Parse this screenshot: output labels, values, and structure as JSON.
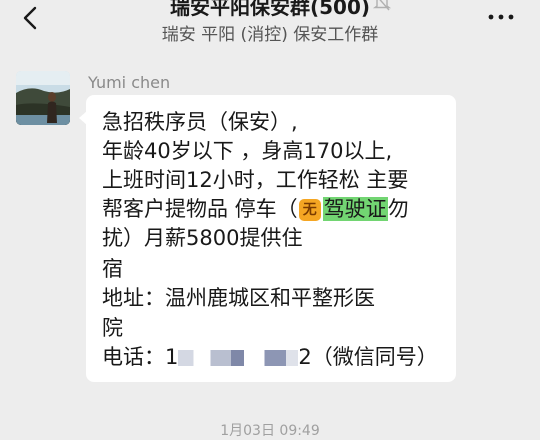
{
  "header": {
    "title": "瑞安平阳保安群(500)",
    "subtitle": "瑞安 平阳 (消控) 保安工作群"
  },
  "message": {
    "sender": "Yumi chen",
    "lines": [
      "急招秩序员（保安）,",
      "年龄40岁以下 ，身高170以上,",
      "上班时间12小时，工作轻松 主要",
      "帮客户提物品 停车（",
      "无",
      "驾驶证",
      "勿",
      "扰）月薪5800提供住",
      "宿",
      "地址：温州鹿城区和平整形医",
      "院",
      "电话：",
      "1",
      "2（微信同号）"
    ]
  },
  "timestamp": "1月03日 09:49",
  "colors": {
    "background": "#ededed",
    "bubble": "#ffffff",
    "highlight": "#72d572",
    "emoji_bg": "#f5a623"
  },
  "icons": [
    "back-arrow-icon",
    "mute-bell-icon",
    "more-dots-icon",
    "no-emoji-icon"
  ]
}
